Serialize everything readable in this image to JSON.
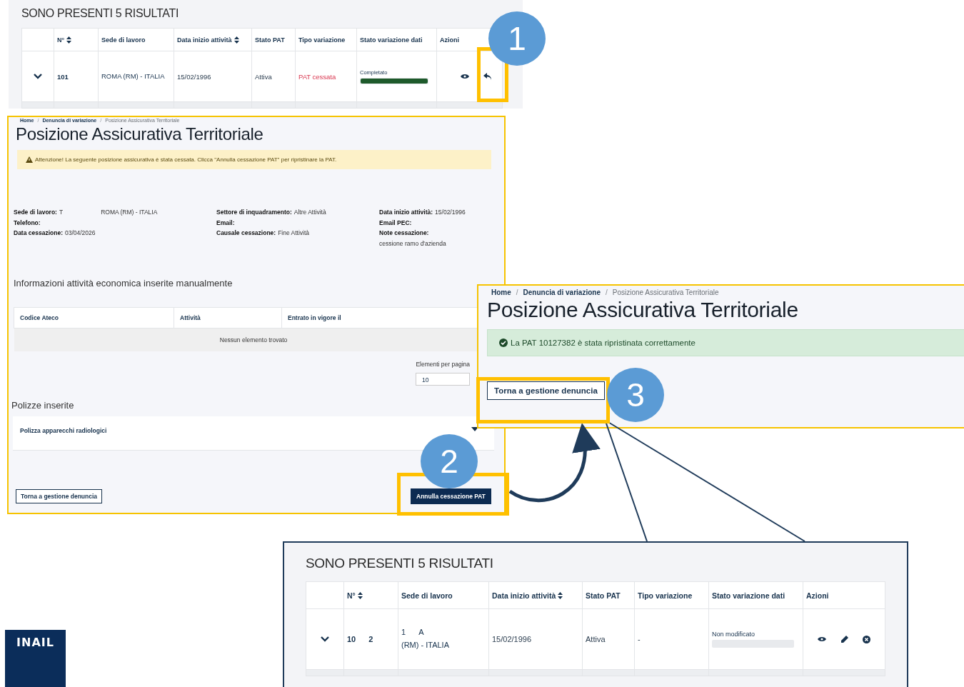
{
  "top_results": {
    "heading": "SONO PRESENTI 5 RISULTATI",
    "columns": [
      {
        "label": "N°",
        "sortable": true
      },
      {
        "label": "Sede di lavoro",
        "sortable": false
      },
      {
        "label": "Data inizio attività",
        "sortable": true
      },
      {
        "label": "Stato PAT",
        "sortable": false
      },
      {
        "label": "Tipo variazione",
        "sortable": false
      },
      {
        "label": "Stato variazione dati",
        "sortable": false
      },
      {
        "label": "Azioni",
        "sortable": false
      }
    ],
    "rows": [
      {
        "number": [
          "101"
        ],
        "sede": [
          [
            "ROMA (RM) - ITALIA"
          ]
        ],
        "date": "15/02/1996",
        "stato_pat": "Attiva",
        "tipo_variazione": {
          "text": "PAT cessata",
          "kind": "alert"
        },
        "stato_variazione": {
          "label": "Completato",
          "level": 1
        },
        "actions": [
          {
            "kind": "view"
          },
          {
            "kind": "undo"
          }
        ]
      }
    ]
  },
  "cessation_page": {
    "breadcrumb": [
      {
        "label": "Home",
        "current": false
      },
      {
        "label": "/",
        "kind": "separator"
      },
      {
        "label": "Denuncia di variazione",
        "current": false
      },
      {
        "label": "/",
        "kind": "separator"
      },
      {
        "label": "Posizione Assicurativa Territoriale",
        "current": true
      }
    ],
    "title": "Posizione Assicurativa Territoriale",
    "warning": "Attenzione! La seguente posizione assicurativa è stata cessata. Clicca \"Annulla cessazione PAT\" per ripristinare la PAT.",
    "details": [
      [
        {
          "label": "Sede di lavoro:",
          "value": [
            "T",
            "ROMA (RM) - ITALIA"
          ]
        },
        {
          "label": "Telefono:"
        },
        {
          "label": "Data cessazione:",
          "value": [
            "03/04/2026"
          ]
        }
      ],
      [
        {
          "label": "Settore di inquadramento:",
          "value": [
            "Altre Attività"
          ]
        },
        {
          "label": "Email:"
        },
        {
          "label": "Causale cessazione:",
          "value": [
            "Fine Attività"
          ]
        }
      ],
      [
        {
          "label": "Data inizio attività:",
          "value": [
            "15/02/1996"
          ]
        },
        {
          "label": "Email PEC:"
        },
        {
          "label": "Note cessazione:",
          "value": [
            "cessione ramo d'azienda"
          ]
        }
      ]
    ],
    "activity_heading": "Informazioni attività economica inserite manualmente",
    "activity_columns": [
      "Codice Ateco",
      "Attività",
      "Entrato in vigore il"
    ],
    "activity_empty": "Nessun elemento trovato",
    "page_size_label": "Elementi per pagina",
    "page_size_value": "10",
    "policies_heading": "Polizze inserite",
    "policies": [
      {
        "title": "Polizza apparecchi radiologici",
        "expanded": false
      }
    ],
    "back_button": "Torna a gestione denuncia",
    "cancel_button": "Annulla cessazione PAT"
  },
  "restored_page": {
    "breadcrumb": [
      {
        "label": "Home",
        "current": false
      },
      {
        "label": "/",
        "kind": "separator"
      },
      {
        "label": "Denuncia di variazione",
        "current": false
      },
      {
        "label": "/",
        "kind": "separator"
      },
      {
        "label": "Posizione Assicurativa Territoriale",
        "current": true
      }
    ],
    "title": "Posizione Assicurativa Territoriale",
    "success": "La PAT 10127382 è stata ripristinata correttamente",
    "back_button": "Torna a gestione denuncia"
  },
  "bottom_results": {
    "heading": "SONO PRESENTI 5 RISULTATI",
    "columns": [
      {
        "label": "N°",
        "sortable": true
      },
      {
        "label": "Sede di lavoro",
        "sortable": false
      },
      {
        "label": "Data inizio attività",
        "sortable": true
      },
      {
        "label": "Stato PAT",
        "sortable": false
      },
      {
        "label": "Tipo variazione",
        "sortable": false
      },
      {
        "label": "Stato variazione dati",
        "sortable": false
      },
      {
        "label": "Azioni",
        "sortable": false
      }
    ],
    "rows": [
      {
        "number": [
          "10",
          "2"
        ],
        "sede": [
          [
            "1",
            "A"
          ],
          [
            "(RM) - ITALIA"
          ]
        ],
        "date": "15/02/1996",
        "stato_pat": "Attiva",
        "tipo_variazione": {
          "text": "-",
          "kind": "plain"
        },
        "stato_variazione": {
          "label": "Non modificato",
          "level": 0
        },
        "actions": [
          {
            "kind": "view"
          },
          {
            "kind": "edit"
          },
          {
            "kind": "remove"
          }
        ]
      }
    ]
  },
  "callouts": [
    "1",
    "2",
    "3"
  ],
  "logo": "INAIL"
}
